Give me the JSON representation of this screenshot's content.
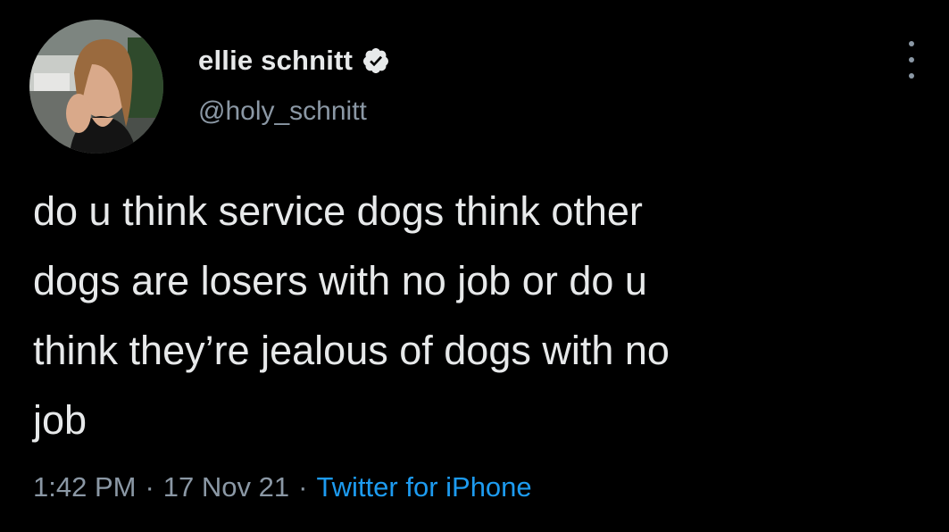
{
  "author": {
    "display_name": "ellie schnitt",
    "handle": "@holy_schnitt",
    "verified": true,
    "avatar": "profile-photo"
  },
  "tweet": {
    "text": "do u think service dogs think other\ndogs are losers with no job or do u\nthink they’re jealous of dogs with no\njob",
    "time": "1:42 PM",
    "date": "17 Nov 21",
    "separator": "·",
    "source": "Twitter for iPhone"
  },
  "icons": {
    "verified": "verified-badge-icon",
    "more": "more-options-icon"
  },
  "colors": {
    "background": "#000000",
    "primary_text": "#e7e9ea",
    "secondary_text": "#8b98a5",
    "link": "#1d9bf0"
  }
}
